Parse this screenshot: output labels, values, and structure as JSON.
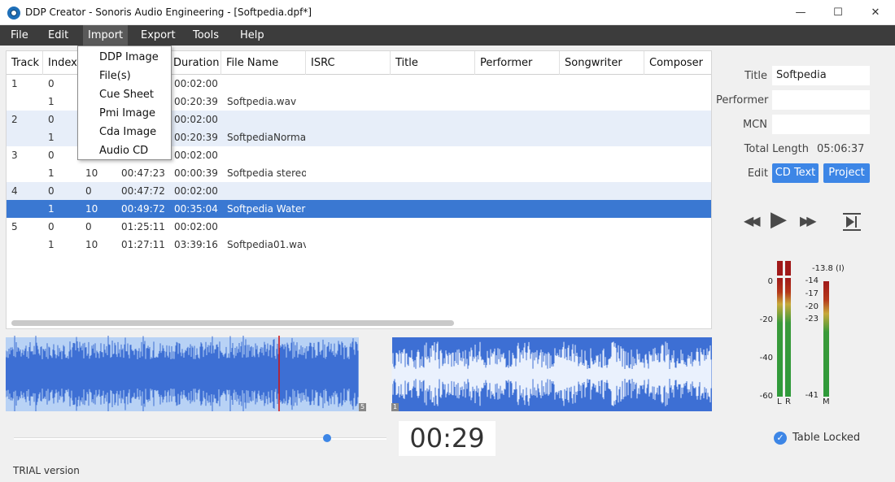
{
  "window": {
    "title": "DDP Creator - Sonoris Audio Engineering - [Softpedia.dpf*]",
    "minimize_glyph": "—",
    "maximize_glyph": "☐",
    "close_glyph": "✕"
  },
  "menu": {
    "file": "File",
    "edit": "Edit",
    "import": "Import",
    "export": "Export",
    "tools": "Tools",
    "help": "Help"
  },
  "import_menu": [
    "DDP Image",
    "File(s)",
    "Cue Sheet",
    "Pmi Image",
    "Cda Image",
    "Audio CD"
  ],
  "table": {
    "headers": {
      "track": "Track",
      "index": "Index",
      "duration": "Duration",
      "file_name": "File Name",
      "isrc": "ISRC",
      "title": "Title",
      "performer": "Performer",
      "songwriter": "Songwriter",
      "composer": "Composer"
    },
    "rows": [
      {
        "track": "1",
        "index": "0",
        "pause": "",
        "start": "",
        "duration": "00:02:00",
        "file": ""
      },
      {
        "track": "",
        "index": "1",
        "pause": "",
        "start": "",
        "duration": "00:20:39",
        "file": "Softpedia.wav"
      },
      {
        "track": "2",
        "index": "0",
        "pause": "",
        "start": "",
        "duration": "00:02:00",
        "file": ""
      },
      {
        "track": "",
        "index": "1",
        "pause": "",
        "start": "",
        "duration": "00:20:39",
        "file": "SoftpediaNormal"
      },
      {
        "track": "3",
        "index": "0",
        "pause": "",
        "start": "",
        "duration": "00:02:00",
        "file": ""
      },
      {
        "track": "",
        "index": "1",
        "pause": "10",
        "start": "00:47:23",
        "duration": "00:00:39",
        "file": "Softpedia stereo"
      },
      {
        "track": "4",
        "index": "0",
        "pause": "0",
        "start": "00:47:72",
        "duration": "00:02:00",
        "file": ""
      },
      {
        "track": "",
        "index": "1",
        "pause": "10",
        "start": "00:49:72",
        "duration": "00:35:04",
        "file": "Softpedia Waterr"
      },
      {
        "track": "5",
        "index": "0",
        "pause": "0",
        "start": "01:25:11",
        "duration": "00:02:00",
        "file": ""
      },
      {
        "track": "",
        "index": "1",
        "pause": "10",
        "start": "01:27:11",
        "duration": "03:39:16",
        "file": "Softpedia01.wav"
      }
    ]
  },
  "waveform": {
    "markers": [
      "5",
      "1"
    ],
    "colors": {
      "wave": "#3d6fd4",
      "selection": "#b8d2f5",
      "playhead": "#d01010"
    }
  },
  "info_panel": {
    "title_label": "Title",
    "title_value": "Softpedia",
    "performer_label": "Performer",
    "performer_value": "",
    "mcn_label": "MCN",
    "mcn_value": "",
    "total_length_label": "Total Length",
    "total_length_value": "05:06:37",
    "edit_label": "Edit",
    "cd_text_button": "CD Text",
    "project_button": "Project"
  },
  "transport": {
    "rewind_glyph": "◀◀",
    "play_glyph": "▶",
    "ffwd_glyph": "▶▶"
  },
  "meters": {
    "scale": [
      "0",
      "-20",
      "-40",
      "-60"
    ],
    "left_label": "L",
    "right_label": "R",
    "mono_label": "M",
    "peak_readout": "-13.8 (I)",
    "mono_scale": [
      "-14",
      "-17",
      "-20",
      "-23",
      "-41"
    ]
  },
  "playback": {
    "position_fraction": 0.84,
    "time": "00:29"
  },
  "table_locked": "Table Locked",
  "status": "TRIAL version",
  "colors": {
    "accent": "#3d86e6",
    "menubar": "#3c3c3c",
    "selected_row": "#3a78d2",
    "alt_row": "#e7eef9"
  }
}
